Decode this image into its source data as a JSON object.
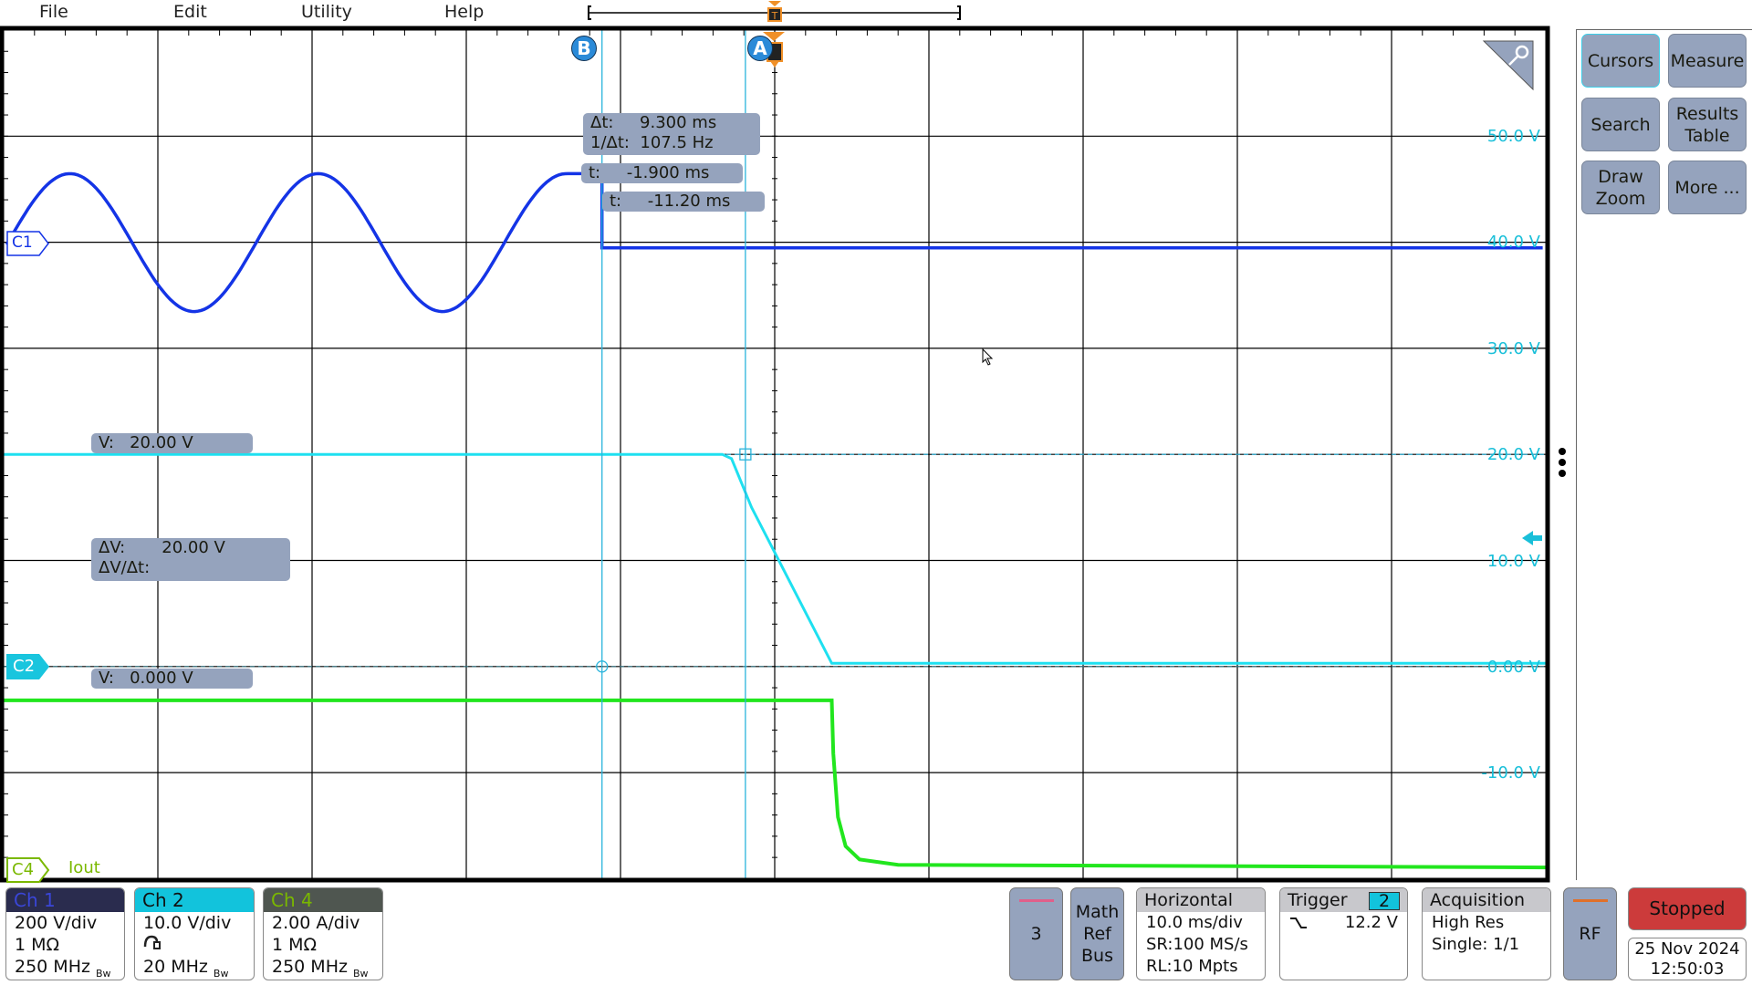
{
  "menu": [
    "File",
    "Edit",
    "Utility",
    "Help"
  ],
  "cursor_labels": {
    "a": "A",
    "b": "B"
  },
  "readouts": {
    "delta_t": "Δt:     9.300 ms",
    "inv_delta_t": "1/Δt:  107.5 Hz",
    "t_a": "t:     -1.900 ms",
    "t_b": "t:     -11.20 ms",
    "v_a": "V:   20.00 V",
    "delta_v": "ΔV:       20.00 V",
    "dv_dt": "ΔV/Δt:",
    "v_b": "V:   0.000 V"
  },
  "scale_labels": [
    "50.0 V",
    "40.0 V",
    "30.0 V",
    "20.0 V",
    "10.0 V",
    "0.00 V",
    "-10.0 V"
  ],
  "channel_markers": {
    "c1": "C1",
    "c2": "C2",
    "c4": "C4",
    "c4_label": "Iout"
  },
  "side_buttons": [
    {
      "label": "Cursors"
    },
    {
      "label": "Measure"
    },
    {
      "label": "Search"
    },
    {
      "label": "Results\nTable"
    },
    {
      "label": "Draw\nZoom"
    },
    {
      "label": "More ..."
    }
  ],
  "channels": [
    {
      "name": "Ch 1",
      "scale": "200 V/div",
      "impedance": "1 MΩ",
      "bandwidth": "250 MHz",
      "bw_icon": "Bw",
      "color": "#2832a0"
    },
    {
      "name": "Ch 2",
      "scale": "10.0 V/div",
      "probe_icon": "probe-icon",
      "bandwidth": "20 MHz",
      "bw_icon": "Bw",
      "color": "#12c3dc"
    },
    {
      "name": "Ch 4",
      "scale": "2.00 A/div",
      "impedance": "1 MΩ",
      "bandwidth": "250 MHz",
      "bw_icon": "Bw",
      "color": "#7ab800"
    }
  ],
  "bottom": {
    "ch3_button": "3",
    "math_ref_bus": "Math\nRef\nBus",
    "horizontal": {
      "title": "Horizontal",
      "scale": "10.0 ms/div",
      "sr": "SR:100 MS/s",
      "rl": "RL:10 Mpts"
    },
    "trigger": {
      "title": "Trigger",
      "source": "2",
      "slope_icon": "falling-edge-icon",
      "level": "12.2 V"
    },
    "acquisition": {
      "title": "Acquisition",
      "mode": "High Res",
      "single": "Single: 1/1"
    },
    "rf": "RF",
    "status": "Stopped",
    "date": "25 Nov 2024",
    "time": "12:50:03"
  },
  "colors": {
    "ch1": "#1434e6",
    "ch2": "#1ee0f0",
    "ch4": "#22e61e",
    "cursor": "#2ab4dc",
    "readout_bg": "#95a3bd",
    "stopped": "#cc3b3b"
  },
  "waveform_settings": {
    "time_per_div_ms": 10,
    "cursor_a_ms": -1.9,
    "cursor_b_ms": -11.2,
    "cursor_a_v": 20,
    "cursor_b_v": 0,
    "trigger_level_v": 12.2
  },
  "waveforms": {
    "ch1": {
      "unit": "V",
      "amplitude": 130,
      "period_ms": 16.1,
      "peak_at_ms": -45.7,
      "step_at_ms": -11.2,
      "level_after": -10
    },
    "ch2": {
      "unit": "V",
      "points": [
        [
          -50,
          20
        ],
        [
          -3.4,
          20
        ],
        [
          -2.8,
          19.6
        ],
        [
          -1.5,
          15
        ],
        [
          3.7,
          0.3
        ],
        [
          50,
          0.3
        ]
      ]
    },
    "ch4": {
      "unit": "A",
      "points": [
        [
          -50,
          3.2
        ],
        [
          3.7,
          3.2
        ],
        [
          3.8,
          2.2
        ],
        [
          4.1,
          1.0
        ],
        [
          4.6,
          0.45
        ],
        [
          5.5,
          0.2
        ],
        [
          8,
          0.1
        ],
        [
          50,
          0.05
        ]
      ]
    }
  }
}
